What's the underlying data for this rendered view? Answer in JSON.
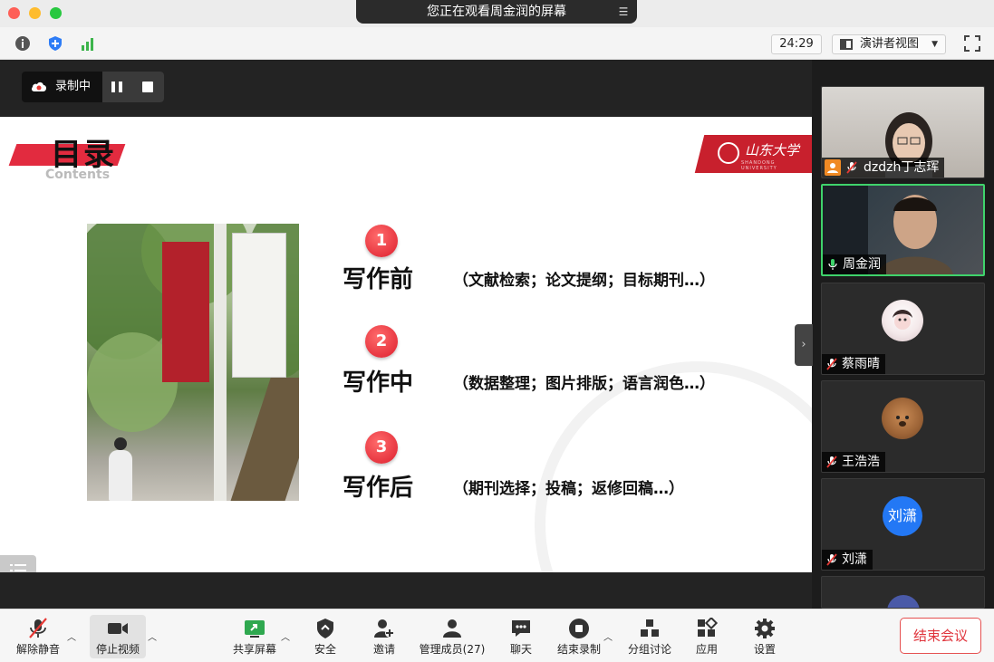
{
  "window": {
    "share_banner": "您正在观看周金润的屏幕"
  },
  "infobar": {
    "timer": "24:29",
    "view_mode": "演讲者视图"
  },
  "recording": {
    "label": "录制中"
  },
  "slide": {
    "title": "目录",
    "subtitle": "Contents",
    "logo_text": "山东大学",
    "logo_subtext": "SHANDONG UNIVERSITY",
    "steps": [
      {
        "num": "1",
        "title": "写作前",
        "desc": "（文献检索；论文提纲；目标期刊…）"
      },
      {
        "num": "2",
        "title": "写作中",
        "desc": "（数据整理；图片排版；语言润色…）"
      },
      {
        "num": "3",
        "title": "写作后",
        "desc": "（期刊选择；投稿；返修回稿…）"
      }
    ]
  },
  "participants": [
    {
      "name": "dzdzh丁志珲",
      "muted": true,
      "has_video": true
    },
    {
      "name": "周金润",
      "muted": false,
      "has_video": true,
      "speaking": true
    },
    {
      "name": "蔡雨晴",
      "muted": true,
      "has_video": false
    },
    {
      "name": "王浩浩",
      "muted": true,
      "has_video": false
    },
    {
      "name": "刘潇",
      "muted": true,
      "has_video": false,
      "avatar_text": "刘潇"
    }
  ],
  "toolbar": {
    "unmute": "解除静音",
    "stop_video": "停止视频",
    "share_screen": "共享屏幕",
    "security": "安全",
    "invite": "邀请",
    "manage_participants": "管理成员(27)",
    "chat": "聊天",
    "stop_recording": "结束录制",
    "breakout": "分组讨论",
    "apps": "应用",
    "settings": "设置",
    "end_meeting": "结束会议"
  },
  "colors": {
    "accent_red": "#dd1f2e",
    "speaking_green": "#3fd36b",
    "avatar_blue": "#2378f5"
  }
}
